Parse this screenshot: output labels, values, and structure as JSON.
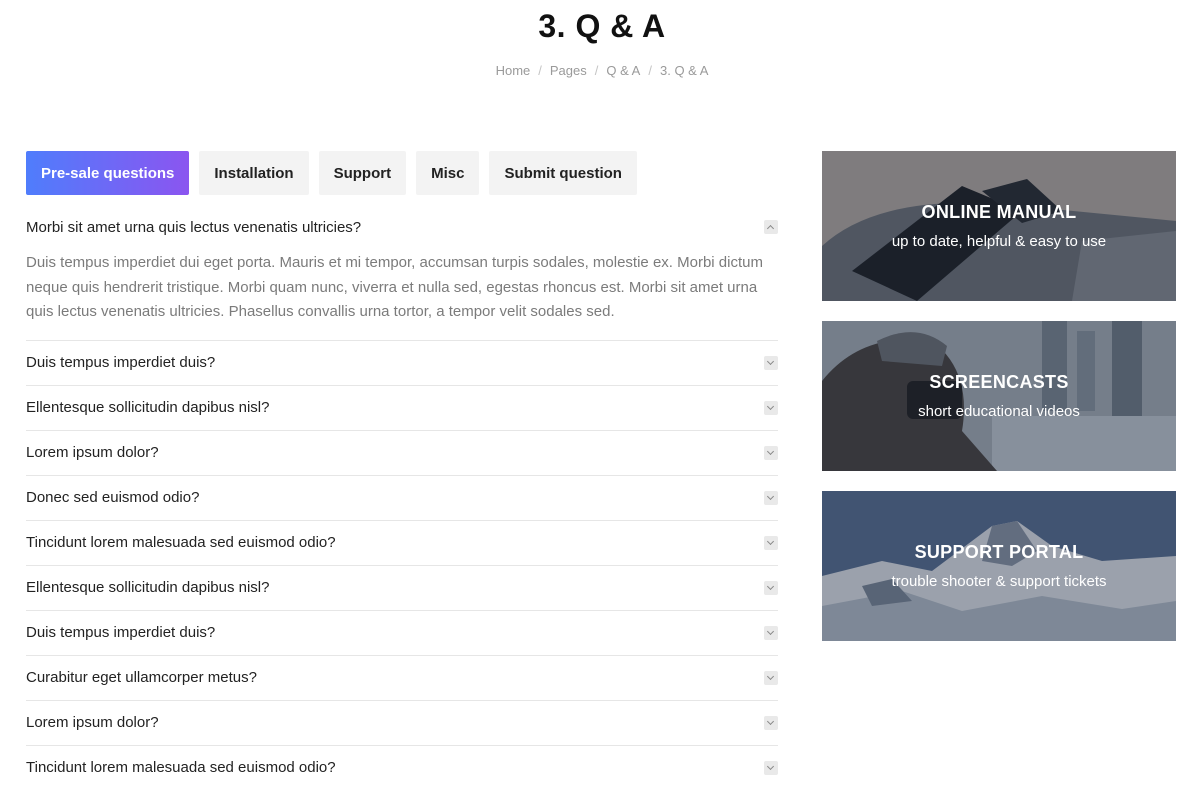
{
  "page": {
    "title": "3. Q & A"
  },
  "breadcrumb": [
    "Home",
    "Pages",
    "Q & A",
    "3. Q & A"
  ],
  "tabs": [
    {
      "label": "Pre-sale questions",
      "active": true
    },
    {
      "label": "Installation",
      "active": false
    },
    {
      "label": "Support",
      "active": false
    },
    {
      "label": "Misc",
      "active": false
    },
    {
      "label": "Submit question",
      "active": false
    }
  ],
  "faq": {
    "open": {
      "question": "Morbi sit amet urna quis lectus venenatis ultricies?",
      "answer": "Duis tempus imperdiet dui eget porta. Mauris et mi tempor, accumsan turpis sodales, molestie ex. Morbi dictum neque quis hendrerit tristique. Morbi quam nunc, viverra et nulla sed, egestas rhoncus est. Morbi sit amet urna quis lectus venenatis ultricies. Phasellus convallis urna tortor, a tempor velit sodales sed."
    },
    "items": [
      "Duis tempus imperdiet duis?",
      "Ellentesque sollicitudin dapibus nisl?",
      "Lorem ipsum dolor?",
      "Donec sed euismod odio?",
      "Tincidunt lorem malesuada sed euismod odio?",
      "Ellentesque sollicitudin dapibus nisl?",
      "Duis tempus imperdiet duis?",
      "Curabitur eget ullamcorper metus?",
      "Lorem ipsum dolor?",
      "Tincidunt lorem malesuada sed euismod odio?"
    ]
  },
  "promos": {
    "manual": {
      "title": "ONLINE MANUAL",
      "subtitle": "up to date, helpful & easy to use"
    },
    "screencasts": {
      "title": "SCREENCASTS",
      "subtitle": "short educational videos"
    },
    "support": {
      "title": "SUPPORT PORTAL",
      "subtitle": "trouble shooter & support tickets"
    }
  },
  "colors": {
    "accent_start": "#4f7dfc",
    "accent_end": "#8b55f0"
  },
  "icons": {
    "faq_toggle_open": "chevron-up-icon",
    "faq_toggle_closed": "chevron-down-icon"
  }
}
